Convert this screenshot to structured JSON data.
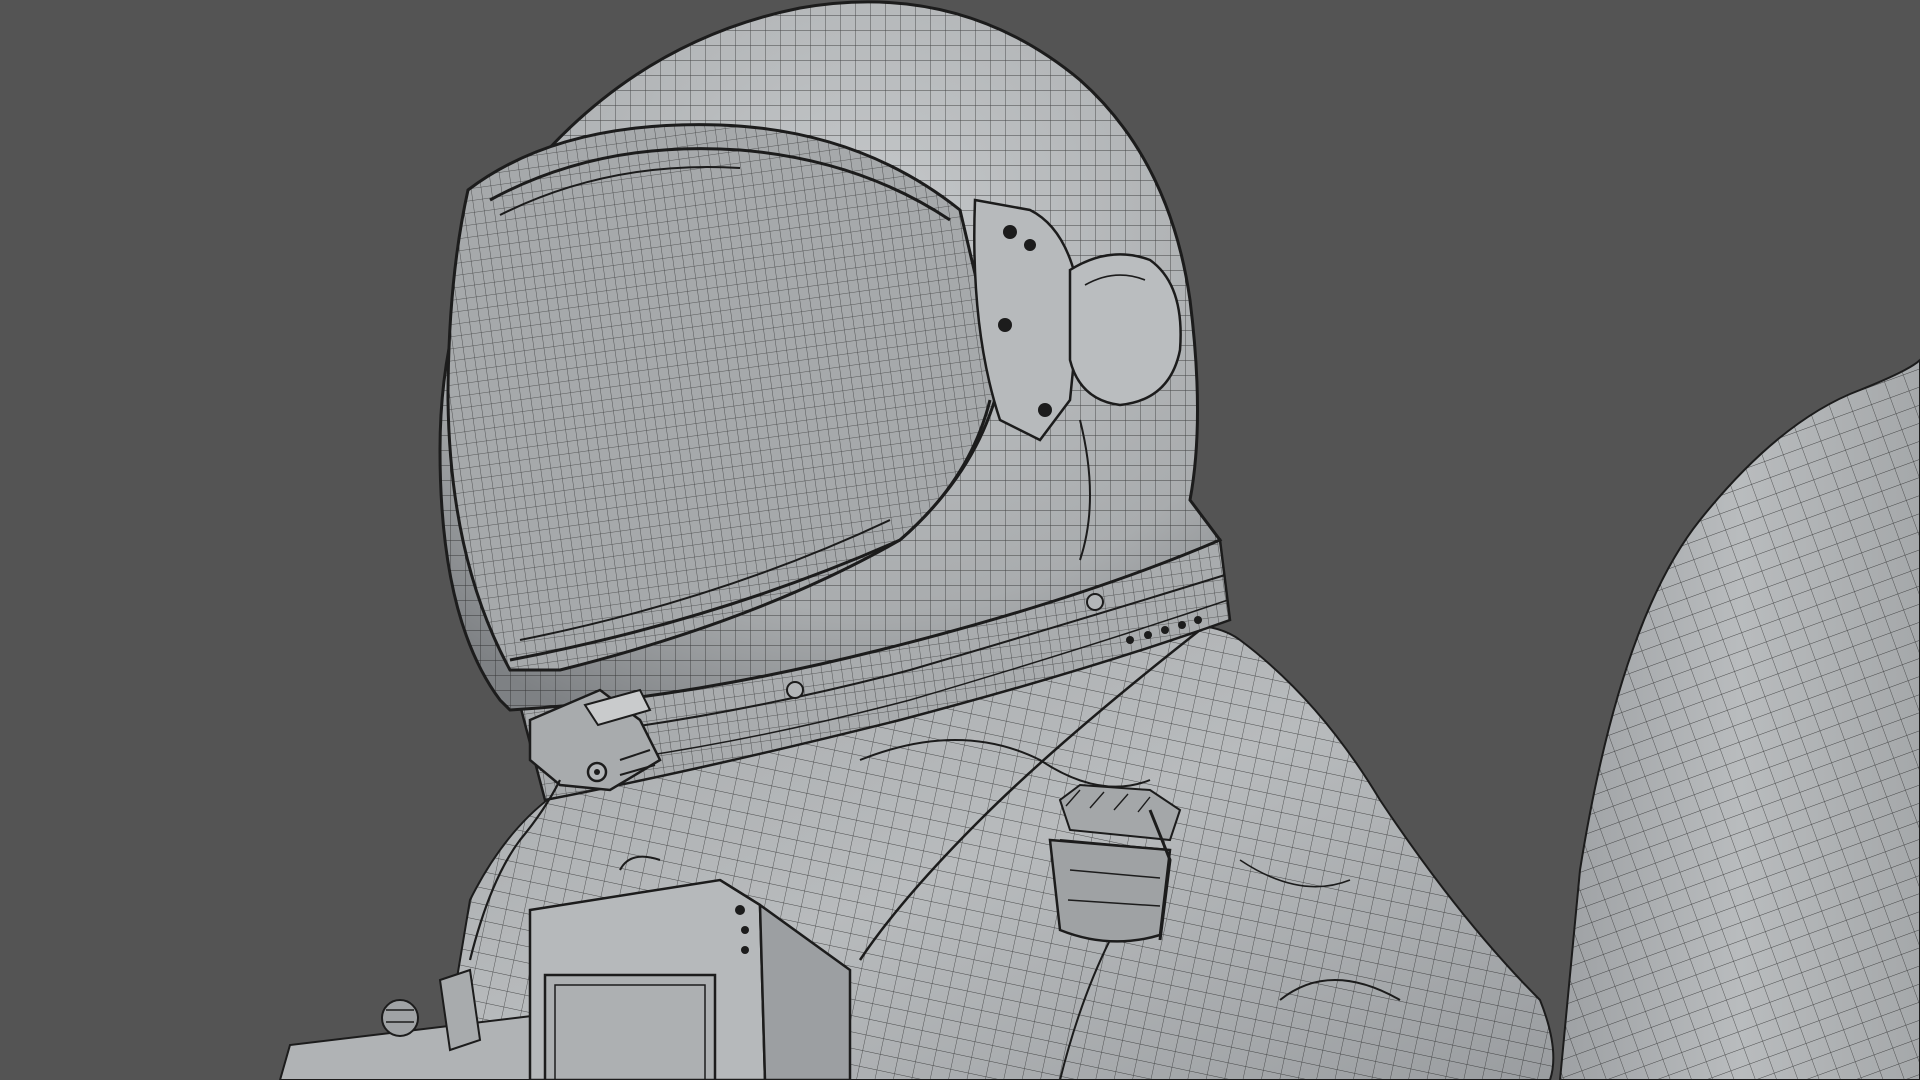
{
  "scene": {
    "background_color": "#545454",
    "model_fill": "#b3b6b8",
    "model_shadow": "#8e9194",
    "model_highlight": "#c9cbcc",
    "wire_color": "#1c1c1c",
    "subject": "astronaut-wireframe-render"
  }
}
